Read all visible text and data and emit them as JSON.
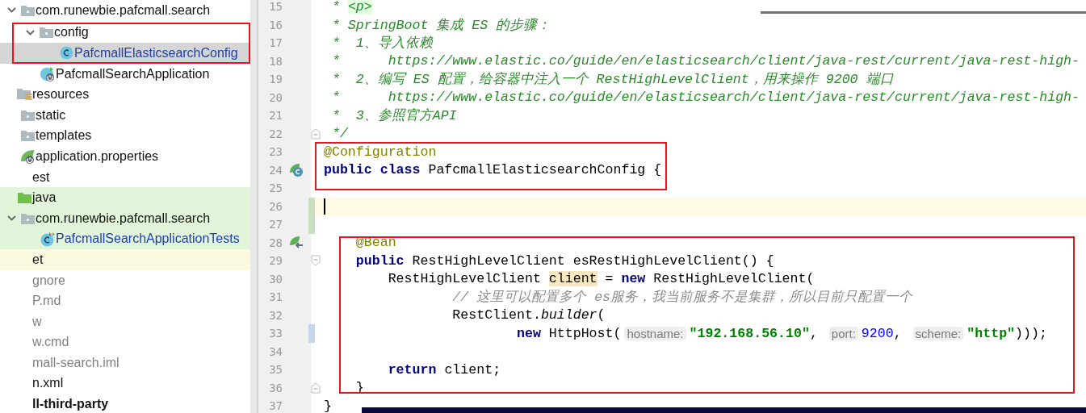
{
  "project_tree": [
    {
      "children": [
        {
          "children": [
            {
              "label": "com.runewbie.pafcmall.search",
              "kind": "package",
              "modified": false,
              "dimmed": false,
              "expanded": true,
              "selected": false,
              "children": [
                {
                  "label": "config",
                  "kind": "package",
                  "modified": false,
                  "dimmed": false,
                  "expanded": true,
                  "selected": false,
                  "outlined": true,
                  "children": [
                    {
                      "label": "PafcmallElasticsearchConfig",
                      "kind": "class",
                      "modified": true,
                      "dimmed": false,
                      "selected": true
                    }
                  ]
                },
                {
                  "label": "PafcmallSearchApplication",
                  "kind": "spring",
                  "modified": false,
                  "dimmed": false,
                  "selected": false
                }
              ]
            }
          ]
        },
        {
          "label": "resources",
          "kind": "resources",
          "modified": false,
          "dimmed": false,
          "selected": false,
          "children": [
            {
              "label": "static",
              "kind": "folder",
              "modified": false,
              "dimmed": false,
              "selected": false
            },
            {
              "label": "templates",
              "kind": "folder",
              "modified": false,
              "dimmed": false,
              "selected": false
            },
            {
              "label": "application.properties",
              "kind": "properties",
              "modified": false,
              "dimmed": false,
              "selected": false
            }
          ]
        }
      ]
    },
    {
      "label": "est",
      "kind": "plain",
      "modified": false,
      "dimmed": false,
      "selected": false,
      "children": [
        {
          "label": "java",
          "kind": "source",
          "modified": false,
          "dimmed": false,
          "selected": false,
          "children": [
            {
              "label": "com.runewbie.pafcmall.search",
              "kind": "package",
              "modified": false,
              "dimmed": false,
              "expanded": true,
              "selected": false,
              "children": [
                {
                  "label": "PafcmallSearchApplicationTests",
                  "kind": "test",
                  "modified": true,
                  "dimmed": false,
                  "selected": false
                }
              ]
            }
          ]
        }
      ]
    },
    {
      "label": "et",
      "kind": "excluded",
      "modified": false,
      "dimmed": false,
      "selected": false
    },
    {
      "label": "gnore",
      "kind": "plain",
      "modified": false,
      "dimmed": true,
      "selected": false
    },
    {
      "label": "P.md",
      "kind": "plain",
      "modified": false,
      "dimmed": true,
      "selected": false
    },
    {
      "label": "w",
      "kind": "plain",
      "modified": false,
      "dimmed": true,
      "selected": false
    },
    {
      "label": "w.cmd",
      "kind": "plain",
      "modified": false,
      "dimmed": true,
      "selected": false
    },
    {
      "label": "mall-search.iml",
      "kind": "plain",
      "modified": false,
      "dimmed": true,
      "selected": false
    },
    {
      "label": "n.xml",
      "kind": "plain",
      "modified": false,
      "dimmed": false,
      "selected": false
    },
    {
      "label": "ll-third-party",
      "kind": "module",
      "modified": false,
      "dimmed": false,
      "selected": false
    }
  ],
  "editor": {
    "blocks": [
      {
        "kind": "plain",
        "lines": [
          {
            "number": "15",
            "kind": "plain",
            "tokens": [
              {
                "kind": "doc",
                "text": " * "
              },
              {
                "kind": "doctag",
                "text": "<p>"
              }
            ]
          },
          {
            "number": "16",
            "kind": "plain",
            "tokens": [
              {
                "kind": "doc",
                "text": " * SpringBoot 集成 ES 的步骤："
              }
            ]
          },
          {
            "number": "17",
            "kind": "plain",
            "tokens": [
              {
                "kind": "doc",
                "text": " *  1、导入依赖"
              }
            ]
          },
          {
            "number": "18",
            "kind": "plain",
            "tokens": [
              {
                "kind": "doc",
                "text": " *      https://www.elastic.co/guide/en/elasticsearch/client/java-rest/current/java-rest-high-"
              }
            ]
          },
          {
            "number": "19",
            "kind": "plain",
            "tokens": [
              {
                "kind": "doc",
                "text": " *  2、编写 ES 配置，给容器中注入一个 RestHighLevelClient，用来操作 9200 端口"
              }
            ]
          },
          {
            "number": "20",
            "kind": "plain",
            "tokens": [
              {
                "kind": "doc",
                "text": " *      https://www.elastic.co/guide/en/elasticsearch/client/java-rest/current/java-rest-high-"
              }
            ]
          },
          {
            "number": "21",
            "kind": "plain",
            "tokens": [
              {
                "kind": "doc",
                "text": " *  3、参照官方API"
              }
            ]
          },
          {
            "number": "22",
            "kind": "foldend",
            "tokens": [
              {
                "kind": "doc",
                "text": " */"
              }
            ]
          }
        ]
      },
      {
        "kind": "boxed",
        "lines": [
          {
            "number": "23",
            "kind": "plain",
            "tokens": [
              {
                "kind": "annotation",
                "text": "@Configuration"
              }
            ]
          },
          {
            "number": "24",
            "kind": "classdecl",
            "tokens": [
              {
                "kind": "keyword",
                "text": "public class"
              },
              {
                "kind": "plain",
                "text": " PafcmallElasticsearchConfig {"
              }
            ]
          },
          {
            "number": "25",
            "kind": "plain"
          }
        ]
      },
      {
        "kind": "plain",
        "lines": [
          {
            "number": "26",
            "kind": "current"
          },
          {
            "number": "27",
            "kind": "added"
          }
        ]
      },
      {
        "kind": "indented",
        "lines": [
          {
            "number": "28",
            "kind": "bean",
            "tokens": [
              {
                "kind": "annotation",
                "text": "    @Bean"
              }
            ]
          },
          {
            "number": "29",
            "kind": "foldstart",
            "tokens": [
              {
                "kind": "keyword",
                "text": "    public"
              },
              {
                "kind": "plain",
                "text": " RestHighLevelClient esRestHighLevelClient() {"
              }
            ]
          },
          {
            "number": "30",
            "kind": "plain",
            "tokens": [
              {
                "kind": "plain",
                "text": "        RestHighLevelClient "
              },
              {
                "kind": "match",
                "text": "client"
              },
              {
                "kind": "plain",
                "text": " = "
              },
              {
                "kind": "keyword",
                "text": "new"
              },
              {
                "kind": "plain",
                "text": " RestHighLevelClient("
              }
            ]
          },
          {
            "number": "31",
            "kind": "plain",
            "tokens": [
              {
                "kind": "comment",
                "text": "                // 这里可以配置多个 es服务，我当前服务不是集群，所以目前只配置一个"
              }
            ]
          },
          {
            "number": "32",
            "kind": "plain",
            "tokens": [
              {
                "kind": "plain",
                "text": "                RestClient."
              },
              {
                "kind": "italic",
                "text": "builder"
              },
              {
                "kind": "plain",
                "text": "("
              }
            ]
          },
          {
            "number": "33",
            "kind": "modified",
            "tokens": [
              {
                "kind": "keyword",
                "text": "                        new"
              },
              {
                "kind": "plain",
                "text": " HttpHost("
              },
              {
                "kind": "hint",
                "text": "hostname:"
              },
              {
                "kind": "string",
                "text": "\"192.168.56.10\""
              },
              {
                "kind": "plain",
                "text": ", "
              },
              {
                "kind": "hint",
                "text": "port:"
              },
              {
                "kind": "number",
                "text": "9200"
              },
              {
                "kind": "plain",
                "text": ", "
              },
              {
                "kind": "hint",
                "text": "scheme:"
              },
              {
                "kind": "string",
                "text": "\"http\""
              },
              {
                "kind": "plain",
                "text": ")));"
              }
            ]
          },
          {
            "number": "34",
            "kind": "plain"
          },
          {
            "number": "35",
            "kind": "plain",
            "tokens": [
              {
                "kind": "keyword",
                "text": "        return"
              },
              {
                "kind": "plain",
                "text": " client;"
              }
            ]
          },
          {
            "number": "36",
            "kind": "foldend",
            "tokens": [
              {
                "kind": "plain",
                "text": "    }"
              }
            ]
          }
        ]
      },
      {
        "kind": "plain",
        "lines": [
          {
            "number": "37",
            "kind": "plain",
            "tokens": [
              {
                "kind": "plain",
                "text": "}"
              }
            ]
          }
        ]
      }
    ]
  }
}
